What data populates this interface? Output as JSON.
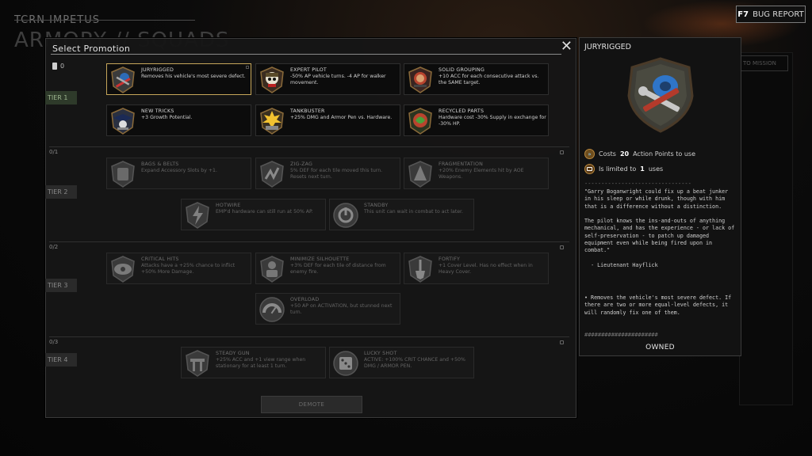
{
  "background": {
    "title": "TCRN IMPETUS",
    "subtitle": "ARMORY // SQUADS",
    "side_button": "TO MISSION"
  },
  "bug_report": {
    "key": "F7",
    "label": "BUG REPORT"
  },
  "modal": {
    "title": "Select Promotion",
    "close_symbol": "✕",
    "promotion_points": "0",
    "demote_label": "DEMOTE",
    "tiers": [
      {
        "label": "TIER 1",
        "count": "",
        "unlocked": true
      },
      {
        "label": "TIER 2",
        "count": "0/1",
        "unlocked": false
      },
      {
        "label": "TIER 3",
        "count": "0/2",
        "unlocked": false
      },
      {
        "label": "TIER 4",
        "count": "0/3",
        "unlocked": false
      }
    ],
    "promotions": [
      {
        "name": "JURYRIGGED",
        "desc": "Removes his vehicle's most severe defect.",
        "icon": "wrench-tape-icon",
        "tier": 1,
        "selected": true
      },
      {
        "name": "EXPERT PILOT",
        "desc": "-50% AP vehicle turns. -4 AP for walker movement.",
        "icon": "skull-pilot-icon",
        "tier": 1
      },
      {
        "name": "SOLID GROUPING",
        "desc": "+10 ACC for each consecutive attack vs. the SAME target.",
        "icon": "grouping-icon",
        "tier": 1
      },
      {
        "name": "NEW TRICKS",
        "desc": "+3 Growth Potential.",
        "icon": "graduation-icon",
        "tier": 1
      },
      {
        "name": "TANKBUSTER",
        "desc": "+25% DMG and Armor Pen vs. Hardware.",
        "icon": "explosion-icon",
        "tier": 1
      },
      {
        "name": "RECYCLED PARTS",
        "desc": "Hardware cost -30% Supply in exchange for -30% HP.",
        "icon": "recycle-icon",
        "tier": 1
      },
      {
        "name": "BAGS & BELTS",
        "desc": "Expand Accessory Slots by +1.",
        "icon": "bag-icon",
        "tier": 2
      },
      {
        "name": "ZIG-ZAG",
        "desc": "5% DEF for each tile moved this turn. Resets next turn.",
        "icon": "zigzag-icon",
        "tier": 2
      },
      {
        "name": "FRAGMENTATION",
        "desc": "+20% Enemy Elements hit by AOE Weapons.",
        "icon": "fragmentation-icon",
        "tier": 2
      },
      {
        "name": "HOTWIRE",
        "desc": "EMP'd hardware can still run at 50% AP.",
        "icon": "hotwire-icon",
        "tier": 2
      },
      {
        "name": "STANDBY",
        "desc": "This unit can wait in combat to act later.",
        "icon": "standby-icon",
        "tier": 2
      },
      {
        "name": "CRITICAL HITS",
        "desc": "Attacks have a +25% chance to inflict +50% More Damage.",
        "icon": "critical-icon",
        "tier": 3
      },
      {
        "name": "MINIMIZE SILHOUETTE",
        "desc": "+3% DEF for each tile of distance from enemy fire.",
        "icon": "silhouette-icon",
        "tier": 3
      },
      {
        "name": "FORTIFY",
        "desc": "+1 Cover Level. Has no effect when in Heavy Cover.",
        "icon": "shovel-icon",
        "tier": 3
      },
      {
        "name": "OVERLOAD",
        "desc": "+50 AP on ACTIVATION, but stunned next turn.",
        "icon": "gauge-icon",
        "tier": 3
      },
      {
        "name": "STEADY GUN",
        "desc": "+25% ACC and +1 view range when stationary for at least 1 turn.",
        "icon": "steady-icon",
        "tier": 4
      },
      {
        "name": "LUCKY SHOT",
        "desc": "ACTIVE: +100% CRIT CHANCE and +50% DMG / ARMOR PEN.",
        "icon": "dice-icon",
        "tier": 4
      }
    ]
  },
  "detail": {
    "title": "JURYRIGGED",
    "icon": "wrench-tape-icon",
    "cost_prefix": "Costs",
    "cost_value": "20",
    "cost_suffix": "Action Points to use",
    "limit_prefix": "Is limited to",
    "limit_value": "1",
    "limit_suffix": "uses",
    "quote": "\"Garry Boganwright could fix up a beat junker in his sleep or while drunk, though with him that is a difference without a distinction.\n\nThe pilot knows the ins-and-outs of anything mechanical, and has the experience - or lack of self-preservation - to patch up damaged equipment even while being fired upon in combat.\"\n\n  - Lieutenant Hayflick",
    "effect": "• Removes the vehicle's most severe defect. If there are two or more equal-level defects, it will randomly fix one of them.",
    "divider_top": "--------------------------------",
    "divider_bottom": "######################",
    "status": "OWNED"
  },
  "colors": {
    "selected_border": "#c6a65a",
    "tier_active": "#2e3a2a"
  }
}
